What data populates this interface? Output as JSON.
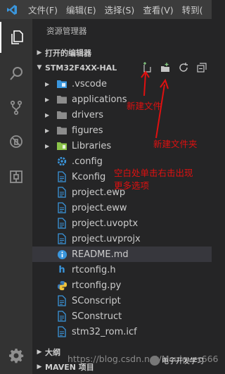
{
  "menubar": {
    "items": [
      "文件(F)",
      "编辑(E)",
      "选择(S)",
      "查看(V)",
      "转到("
    ]
  },
  "activity_icons": [
    "explorer-icon",
    "search-icon",
    "source-control-icon",
    "debug-icon",
    "extensions-icon",
    "gear-icon"
  ],
  "sidebar": {
    "title": "资源管理器",
    "open_editors": "打开的编辑器",
    "project": "STM32F4XX-HAL",
    "outline": "大纲",
    "maven": "MAVEN 项目"
  },
  "tree": [
    {
      "name": ".vscode",
      "type": "folder-vscode",
      "color": "#3a96dd"
    },
    {
      "name": "applications",
      "type": "folder",
      "color": "#8c8c8c"
    },
    {
      "name": "drivers",
      "type": "folder",
      "color": "#8c8c8c"
    },
    {
      "name": "figures",
      "type": "folder",
      "color": "#8c8c8c"
    },
    {
      "name": "Libraries",
      "type": "folder-lib",
      "color": "#8bc34a"
    },
    {
      "name": ".config",
      "type": "gear",
      "color": "#3a96dd"
    },
    {
      "name": "Kconfig",
      "type": "file",
      "color": "#3a96dd"
    },
    {
      "name": "project.ewp",
      "type": "file",
      "color": "#3a96dd"
    },
    {
      "name": "project.eww",
      "type": "file",
      "color": "#3a96dd"
    },
    {
      "name": "project.uvoptx",
      "type": "file",
      "color": "#3a96dd"
    },
    {
      "name": "project.uvprojx",
      "type": "file",
      "color": "#3a96dd"
    },
    {
      "name": "README.md",
      "type": "info",
      "color": "#3a96dd",
      "selected": true
    },
    {
      "name": "rtconfig.h",
      "type": "h",
      "color": "#3a96dd"
    },
    {
      "name": "rtconfig.py",
      "type": "py",
      "color": "#3a96dd"
    },
    {
      "name": "SConscript",
      "type": "file",
      "color": "#3a96dd"
    },
    {
      "name": "SConstruct",
      "type": "file",
      "color": "#3a96dd"
    },
    {
      "name": "stm32_rom.icf",
      "type": "file",
      "color": "#3a96dd"
    }
  ],
  "annotations": {
    "new_file": "新建文件",
    "new_folder": "新建文件夹",
    "right_click_1": "空白处单击右击出现",
    "right_click_2": "更多选项"
  },
  "watermark": {
    "url": "https://blog.csdn.net/Mculover666",
    "brand": "电子开发学习"
  },
  "colors": {
    "annotation": "#e01010",
    "accent": "#3a96dd"
  }
}
